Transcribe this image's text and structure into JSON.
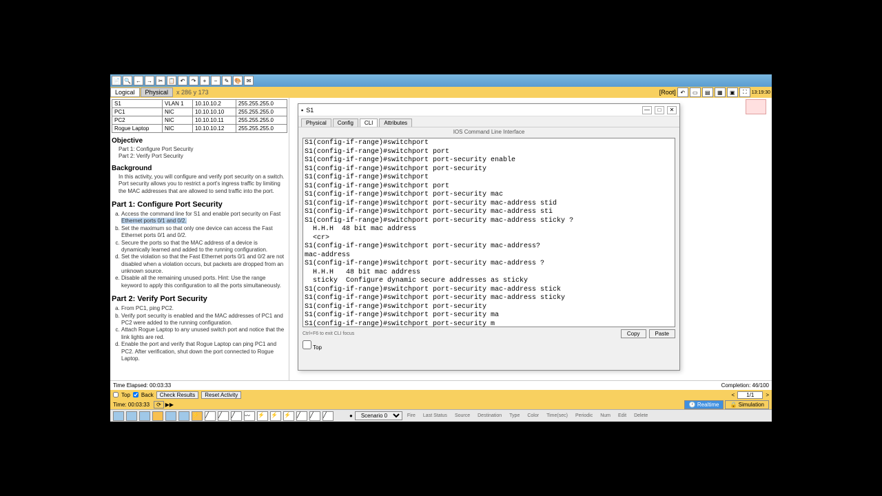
{
  "toolbar": {
    "icons": [
      "new",
      "open",
      "save",
      "print",
      "copy",
      "paste",
      "undo",
      "redo",
      "zoom+",
      "zoom-",
      "draw",
      "palette",
      "envelope"
    ]
  },
  "tabs": {
    "logical": "Logical",
    "physical": "Physical",
    "coords": "x 286 y 173",
    "root": "[Root]"
  },
  "addressing": {
    "rows": [
      [
        "S1",
        "VLAN 1",
        "10.10.10.2",
        "255.255.255.0"
      ],
      [
        "PC1",
        "NIC",
        "10.10.10.10",
        "255.255.255.0"
      ],
      [
        "PC2",
        "NIC",
        "10.10.10.11",
        "255.255.255.0"
      ],
      [
        "Rogue Laptop",
        "NIC",
        "10.10.10.12",
        "255.255.255.0"
      ]
    ]
  },
  "doc": {
    "objective": "Objective",
    "obj1": "Part 1: Configure Port Security",
    "obj2": "Part 2: Verify Port Security",
    "background": "Background",
    "bgtext": "In this activity, you will configure and verify port security on a switch. Port security allows you to restrict a port's ingress traffic by limiting the MAC addresses that are allowed to send traffic into the port.",
    "part1": "Part 1:  Configure Port Security",
    "p1a": "Access the command line for S1 and enable port security on Fast",
    "p1a2": "Ethernet ports 0/1 and 0/2.",
    "p1b": "Set the maximum so that only one device can access the Fast Ethernet ports 0/1 and 0/2.",
    "p1c": "Secure the ports so that the MAC address of a device is dynamically learned and added to the running configuration.",
    "p1d": "Set the violation so that the Fast Ethernet ports 0/1 and 0/2 are not disabled when a violation occurs, but packets are dropped from an unknown source.",
    "p1e": "Disable all the remaining unused ports. Hint: Use the range keyword to apply this configuration to all the ports simultaneously.",
    "part2": "Part 2:  Verify Port Security",
    "p2a": "From PC1, ping PC2.",
    "p2b": "Verify port security is enabled and the MAC addresses of PC1 and PC2 were added to the running configuration.",
    "p2c": "Attach Rogue Laptop to any unused switch port and notice that the link lights are red.",
    "p2d": "Enable the port and verify that Rogue Laptop can ping PC1 and PC2. After verification, shut down the port connected to Rogue Laptop."
  },
  "status": {
    "time": "Time Elapsed: 00:03:33",
    "completion": "Completion: 46/100",
    "time2": "Time: 00:03:33"
  },
  "controls": {
    "top": "Top",
    "back": "Back",
    "check": "Check Results",
    "reset": "Reset Activity",
    "page": "1/1"
  },
  "cli": {
    "title": "S1",
    "tabs": [
      "Physical",
      "Config",
      "CLI",
      "Attributes"
    ],
    "header": "IOS Command Line Interface",
    "lines": [
      "S1(config-if-range)#switchport",
      "S1(config-if-range)#switchport port",
      "S1(config-if-range)#switchport port-security enable",
      "S1(config-if-range)#switchport port-security",
      "S1(config-if-range)#switchport",
      "S1(config-if-range)#switchport port",
      "S1(config-if-range)#switchport port-security mac",
      "S1(config-if-range)#switchport port-security mac-address stid",
      "S1(config-if-range)#switchport port-security mac-address sti",
      "S1(config-if-range)#switchport port-security mac-address sticky ?",
      "  H.H.H  48 bit mac address",
      "  <cr>",
      "S1(config-if-range)#switchport port-security mac-address?",
      "mac-address",
      "S1(config-if-range)#switchport port-security mac-address ?",
      "  H.H.H   48 bit mac address",
      "  sticky  Configure dynamic secure addresses as sticky",
      "S1(config-if-range)#switchport port-security mac-address stick",
      "S1(config-if-range)#switchport port-security mac-address sticky",
      "S1(config-if-range)#switchport port-security",
      "S1(config-if-range)#switchport port-security ma",
      "S1(config-if-range)#switchport port-security m"
    ],
    "footer": "Ctrl+F6 to exit CLI focus",
    "copy": "Copy",
    "paste": "Paste",
    "topchk": "Top"
  },
  "modes": {
    "realtime": "Realtime",
    "simulation": "Simulation"
  },
  "scenario": "Scenario 0",
  "cols": [
    "Fire",
    "Last Status",
    "Source",
    "Destination",
    "Type",
    "Color",
    "Time(sec)",
    "Periodic",
    "Num",
    "Edit",
    "Delete"
  ]
}
